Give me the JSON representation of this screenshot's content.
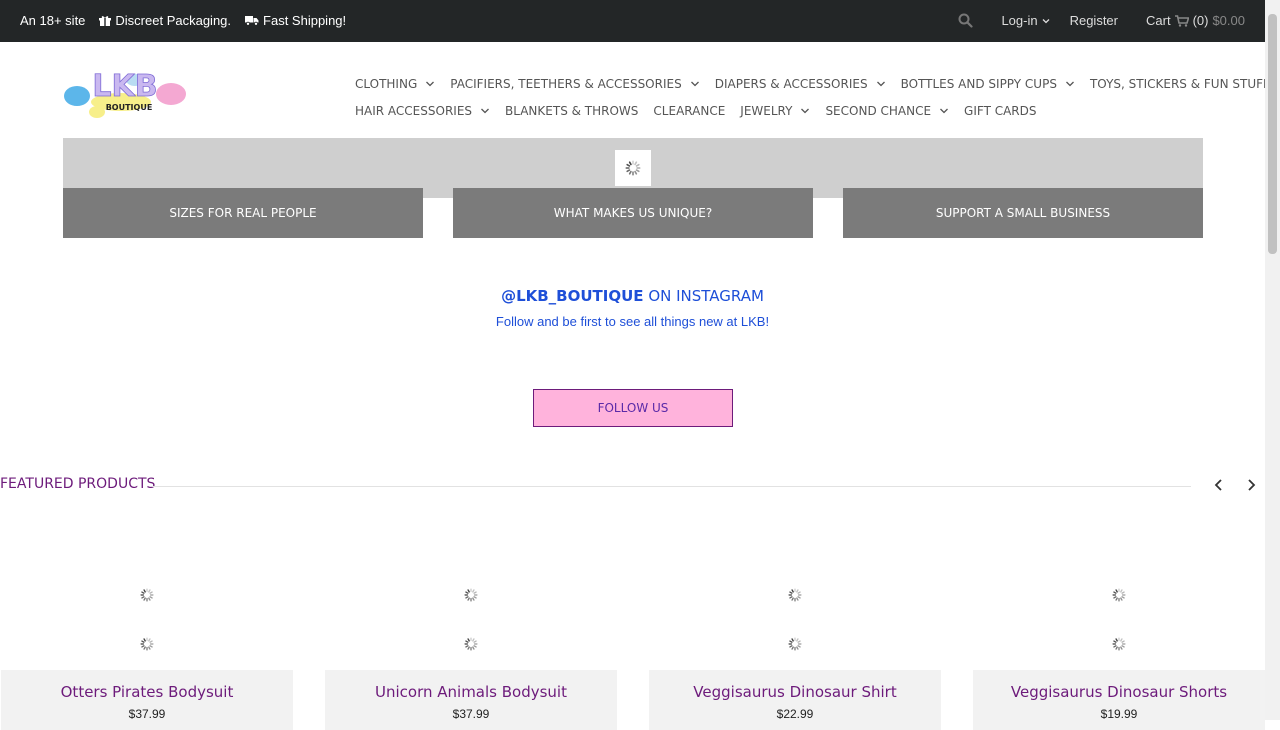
{
  "topbar": {
    "age_notice": "An 18+ site",
    "packaging": "Discreet Packaging.",
    "shipping": "Fast Shipping!",
    "login": "Log-in",
    "register": "Register",
    "cart_label": "Cart",
    "cart_count": "(0)",
    "cart_total": "$0.00"
  },
  "logo": {
    "text": "LKB",
    "sub": "BOUTIQUE"
  },
  "nav": {
    "row1": [
      {
        "label": "CLOTHING",
        "has_dropdown": true
      },
      {
        "label": "PACIFIERS, TEETHERS & ACCESSORIES",
        "has_dropdown": true
      },
      {
        "label": "DIAPERS & ACCESSORIES",
        "has_dropdown": true
      },
      {
        "label": "BOTTLES AND SIPPY CUPS",
        "has_dropdown": true
      },
      {
        "label": "TOYS, STICKERS & FUN STUFF",
        "has_dropdown": true
      }
    ],
    "row2": [
      {
        "label": "HAIR ACCESSORIES",
        "has_dropdown": true
      },
      {
        "label": "BLANKETS & THROWS",
        "has_dropdown": false
      },
      {
        "label": "CLEARANCE",
        "has_dropdown": false
      },
      {
        "label": "JEWELRY",
        "has_dropdown": true
      },
      {
        "label": "SECOND CHANCE",
        "has_dropdown": true
      },
      {
        "label": "GIFT CARDS",
        "has_dropdown": false
      }
    ]
  },
  "tiles": [
    "SIZES FOR REAL PEOPLE",
    "WHAT MAKES US UNIQUE?",
    "SUPPORT A SMALL BUSINESS"
  ],
  "instagram": {
    "handle": "@LKB_BOUTIQUE",
    "suffix": "ON INSTAGRAM",
    "subtitle": "Follow and be first to see all things new at LKB!",
    "follow_button": "FOLLOW US"
  },
  "featured": {
    "title": "FEATURED PRODUCTS",
    "products": [
      {
        "name": "Otters Pirates Bodysuit",
        "price": "$37.99"
      },
      {
        "name": "Unicorn Animals Bodysuit",
        "price": "$37.99"
      },
      {
        "name": "Veggisaurus Dinosaur Shirt",
        "price": "$22.99"
      },
      {
        "name": "Veggisaurus Dinosaur Shorts",
        "price": "$19.99"
      }
    ]
  },
  "colors": {
    "topbar_bg": "#232627",
    "accent_purple": "#6d1b7b",
    "link_blue": "#1e4fd8",
    "follow_pink": "#ffb3dc",
    "tile_gray": "#7b7b7b"
  }
}
